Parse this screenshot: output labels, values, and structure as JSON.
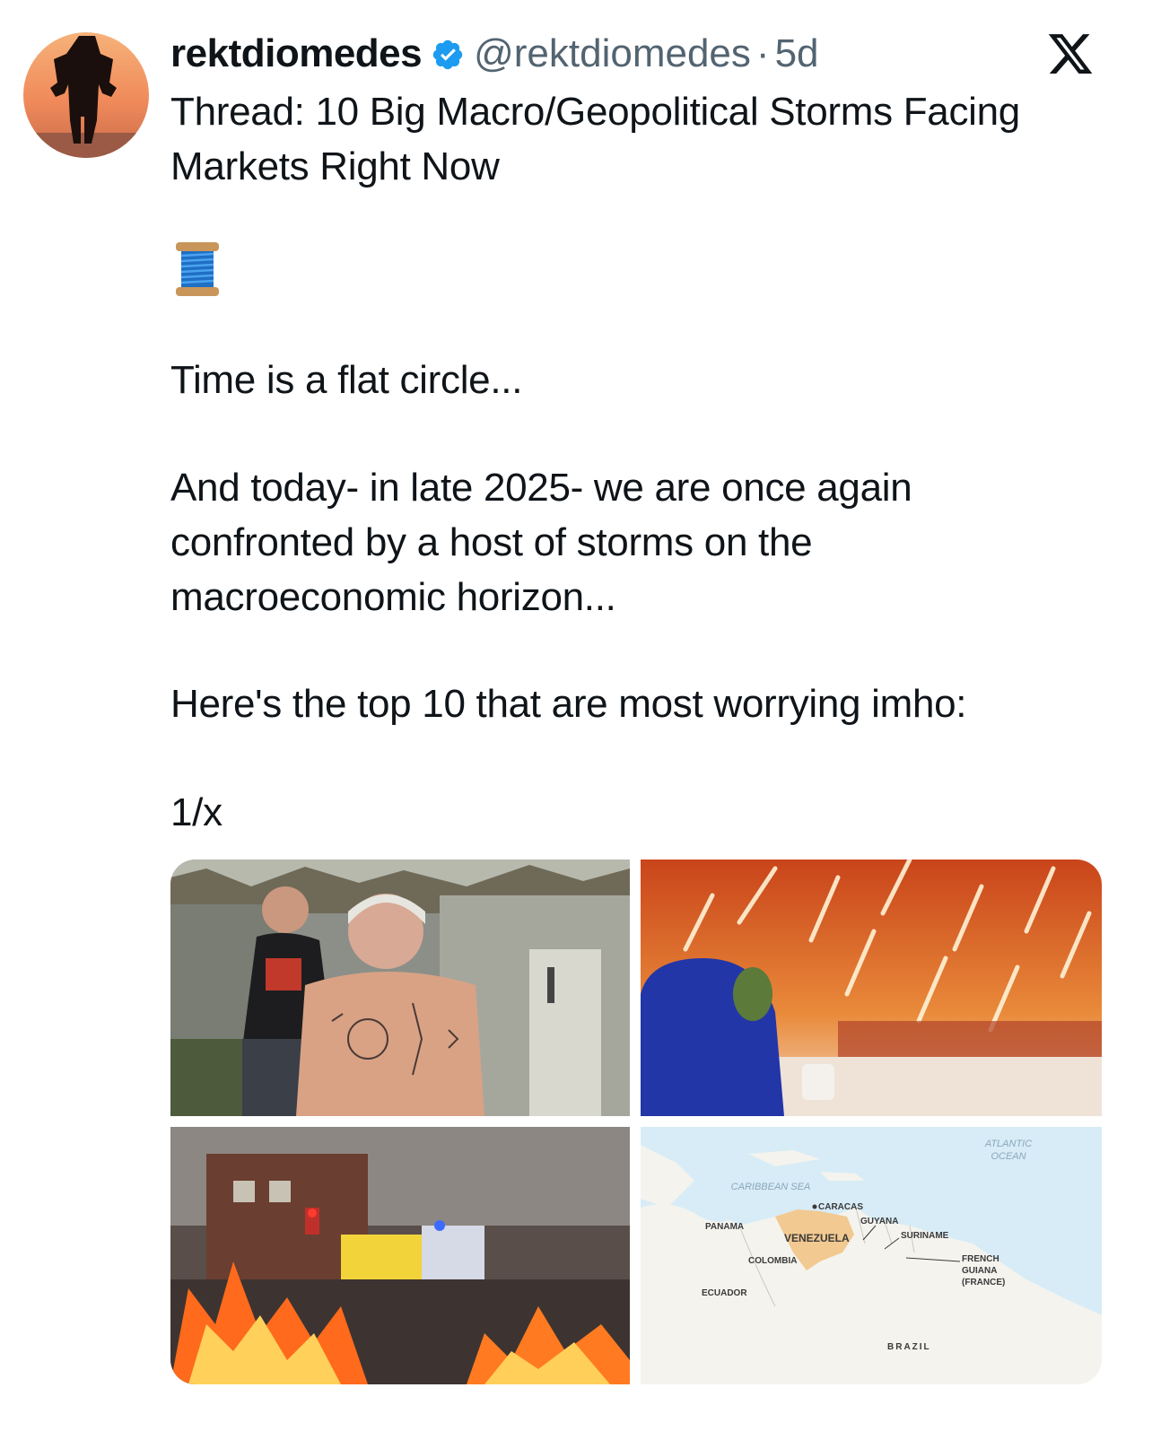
{
  "tweet": {
    "display_name": "rektdiomedes",
    "handle": "@rektdiomedes",
    "separator": "·",
    "time": "5d",
    "title_line1": "Thread: 10 Big Macro/Geopolitical Storms Facing",
    "title_line2": "Markets Right Now",
    "emoji": "🧵",
    "para1": "Time is a flat circle...",
    "para2_line1": "And today- in late 2025- we are once again",
    "para2_line2": "confronted by a host of storms on the",
    "para2_line3": "macroeconomic horizon...",
    "para3": "Here's the top 10 that are most worrying imho:",
    "para4": "1/x"
  },
  "icons": {
    "verified": "verified-badge-icon",
    "platform": "x-logo-icon"
  },
  "colors": {
    "verified_blue": "#1d9bf0",
    "secondary_text": "#536471",
    "primary_text": "#0f1419"
  },
  "media": {
    "map": {
      "atlantic_1": "ATLANTIC",
      "atlantic_2": "OCEAN",
      "caribbean": "CARIBBEAN SEA",
      "caracas": "CARACAS",
      "guyana": "GUYANA",
      "panama": "PANAMA",
      "venezuela": "VENEZUELA",
      "suriname": "SURINAME",
      "colombia": "COLOMBIA",
      "french_1": "FRENCH",
      "french_2": "GUIANA",
      "french_3": "(FRANCE)",
      "ecuador": "ECUADOR",
      "brazil": "BRAZIL"
    }
  }
}
